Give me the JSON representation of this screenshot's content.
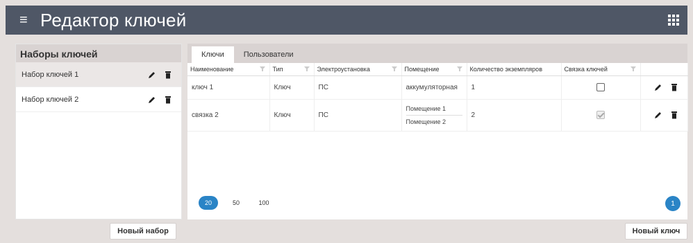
{
  "app": {
    "title": "Редактор ключей"
  },
  "icons": {
    "menu": "menu-icon",
    "apps": "apps-grid-icon",
    "edit": "pencil-icon",
    "delete": "trash-icon",
    "filter": "filter-icon"
  },
  "colors": {
    "topbar": "#4f5766",
    "accent": "#2a84c6",
    "panel_header": "#d9d3d2"
  },
  "key_sets": {
    "header": "Наборы ключей",
    "items": [
      {
        "name": "Набор ключей 1",
        "selected": true
      },
      {
        "name": "Набор ключей 2",
        "selected": false
      }
    ],
    "new_button": "Новый набор"
  },
  "tabs": [
    {
      "label": "Ключи",
      "active": true
    },
    {
      "label": "Пользователи",
      "active": false
    }
  ],
  "table": {
    "columns": [
      "Наименование",
      "Тип",
      "Электроустановка",
      "Помещение",
      "Количество экземпляров",
      "Связка ключей",
      ""
    ],
    "rows": [
      {
        "name": "ключ 1",
        "type": "Ключ",
        "installation": "ПС",
        "rooms": [
          "аккумуляторная"
        ],
        "count": "1",
        "bundle": false
      },
      {
        "name": "связка 2",
        "type": "Ключ",
        "installation": "ПС",
        "rooms": [
          "Помещение 1",
          "Помещение 2"
        ],
        "count": "2",
        "bundle": true
      }
    ]
  },
  "pagination": {
    "page_sizes": [
      "20",
      "50",
      "100"
    ],
    "selected_size": "20",
    "current_page": "1"
  },
  "new_key_button": "Новый ключ"
}
